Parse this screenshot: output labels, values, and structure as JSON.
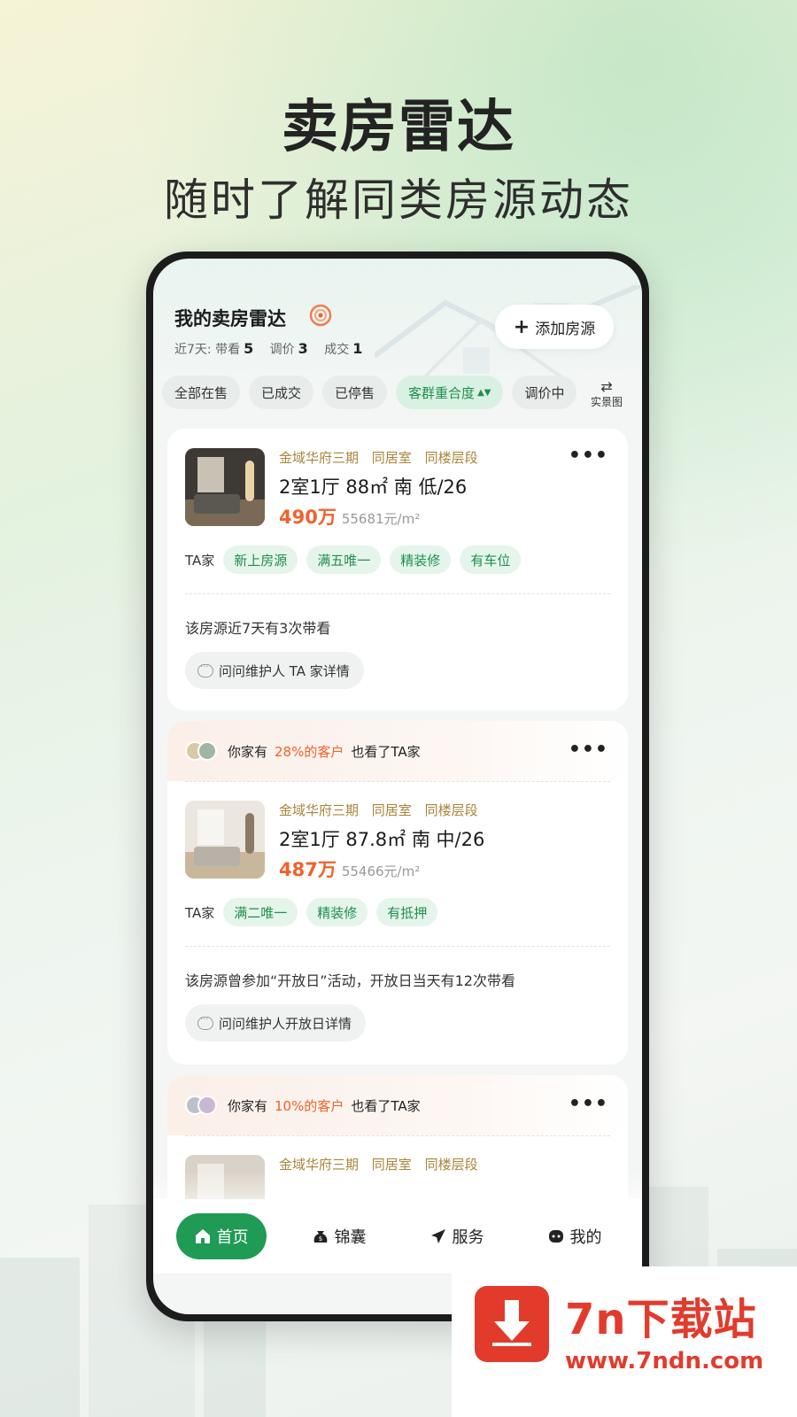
{
  "hero": {
    "title": "卖房雷达",
    "subtitle": "随时了解同类房源动态"
  },
  "radar": {
    "title": "我的卖房雷达",
    "stats_prefix": "近7天:",
    "stats": [
      {
        "label": "带看",
        "value": "5"
      },
      {
        "label": "调价",
        "value": "3"
      },
      {
        "label": "成交",
        "value": "1"
      }
    ],
    "add_button": "添加房源",
    "filters": [
      "全部在售",
      "已成交",
      "已停售",
      "客群重合度",
      "调价中"
    ],
    "active_filter": "客群重合度",
    "view_toggle": "实景图"
  },
  "cards": [
    {
      "community": "金域华府三期",
      "badges": [
        "同居室",
        "同楼层段"
      ],
      "spec": "2室1厅 88㎡ 南 低/26",
      "price": "490万",
      "unit_price": "55681元/m²",
      "owner": "TA家",
      "tags": [
        "新上房源",
        "满五唯一",
        "精装修",
        "有车位"
      ],
      "note": "该房源近7天有3次带看",
      "ask": "问问维护人 TA 家详情",
      "more": "•••"
    },
    {
      "header_prefix": "你家有",
      "header_pct": "28%的客户",
      "header_suffix": "也看了TA家",
      "community": "金域华府三期",
      "badges": [
        "同居室",
        "同楼层段"
      ],
      "spec": "2室1厅 87.8㎡ 南 中/26",
      "price": "487万",
      "unit_price": "55466元/m²",
      "owner": "TA家",
      "tags": [
        "满二唯一",
        "精装修",
        "有抵押"
      ],
      "note": "该房源曾参加“开放日”活动，开放日当天有12次带看",
      "ask": "问问维护人开放日详情",
      "more": "•••"
    },
    {
      "header_prefix": "你家有",
      "header_pct": "10%的客户",
      "header_suffix": "也看了TA家",
      "community": "金域华府三期",
      "badges": [
        "同居室",
        "同楼层段"
      ],
      "more": "•••"
    }
  ],
  "tabbar": [
    {
      "label": "首页",
      "icon": "home-icon",
      "active": true
    },
    {
      "label": "锦囊",
      "icon": "bag-icon",
      "active": false
    },
    {
      "label": "服务",
      "icon": "send-icon",
      "active": false
    },
    {
      "label": "我的",
      "icon": "profile-icon",
      "active": false
    }
  ],
  "watermark": {
    "title": "7n下载站",
    "url": "www.7ndn.com"
  },
  "colors": {
    "accent_green": "#1f9b55",
    "price_orange": "#f0622b",
    "community_gold": "#a7853c",
    "watermark_red": "#e23b2c"
  }
}
